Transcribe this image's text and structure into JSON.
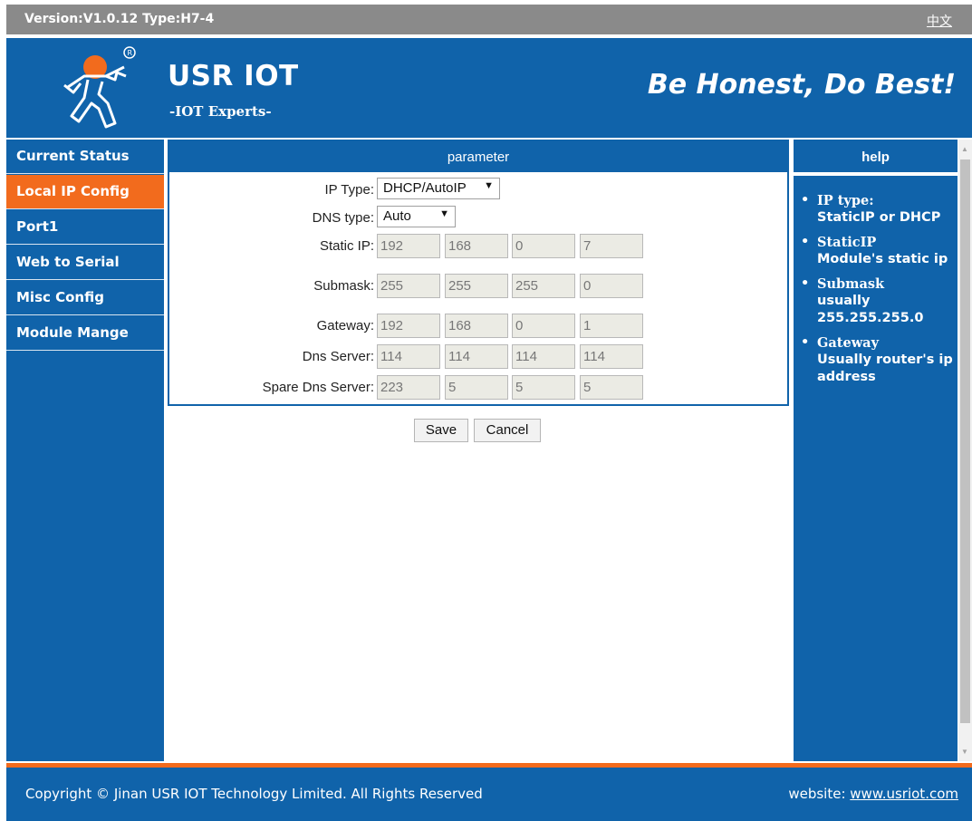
{
  "topbar": {
    "version": "Version:V1.0.12 Type:H7-4",
    "language_link": "中文"
  },
  "header": {
    "brand": "USR IOT",
    "tagline": "-IOT Experts-",
    "slogan": "Be Honest, Do Best!"
  },
  "sidebar": {
    "items": [
      {
        "label": "Current Status"
      },
      {
        "label": "Local IP Config",
        "active": true
      },
      {
        "label": "Port1"
      },
      {
        "label": "Web to Serial"
      },
      {
        "label": "Misc Config"
      },
      {
        "label": "Module Mange"
      }
    ]
  },
  "panel": {
    "title": "parameter",
    "ip_type": {
      "label": "IP Type:",
      "value": "DHCP/AutoIP"
    },
    "dns_type": {
      "label": "DNS type:",
      "value": "Auto"
    },
    "static_ip": {
      "label": "Static IP:",
      "octets": [
        "192",
        "168",
        "0",
        "7"
      ]
    },
    "submask": {
      "label": "Submask:",
      "octets": [
        "255",
        "255",
        "255",
        "0"
      ]
    },
    "gateway": {
      "label": "Gateway:",
      "octets": [
        "192",
        "168",
        "0",
        "1"
      ]
    },
    "dns_server": {
      "label": "Dns Server:",
      "octets": [
        "114",
        "114",
        "114",
        "114"
      ]
    },
    "spare_dns_server": {
      "label": "Spare Dns Server:",
      "octets": [
        "223",
        "5",
        "5",
        "5"
      ]
    }
  },
  "buttons": {
    "save": "Save",
    "cancel": "Cancel"
  },
  "help": {
    "title": "help",
    "items": [
      {
        "term": "IP type:",
        "desc": "StaticIP or DHCP"
      },
      {
        "term": "StaticIP",
        "desc": "Module's static ip"
      },
      {
        "term": "Submask",
        "desc": "usually 255.255.255.0"
      },
      {
        "term": "Gateway",
        "desc": "Usually router's ip address"
      }
    ]
  },
  "footer": {
    "copyright": "Copyright © Jinan USR IOT Technology Limited. All Rights Reserved",
    "website_label": "website:",
    "website_link": "www.usriot.com"
  },
  "colors": {
    "brand_blue": "#1063aa",
    "accent_orange": "#f26b1d",
    "topbar_gray": "#8a8a8a"
  }
}
